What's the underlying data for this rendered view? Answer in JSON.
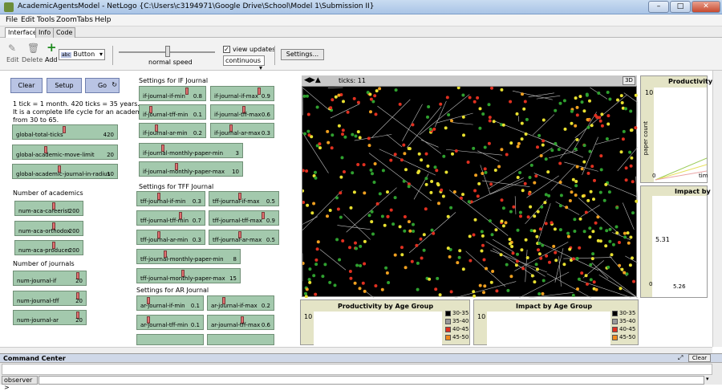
{
  "window": {
    "title": "AcademicAgentsModel - NetLogo {C:\\Users\\c3194971\\Google Drive\\School\\Model 1\\Submission II}"
  },
  "menu": [
    "File",
    "Edit",
    "Tools",
    "Zoom",
    "Tabs",
    "Help"
  ],
  "tabs": [
    "Interface",
    "Info",
    "Code"
  ],
  "toolbar": {
    "edit": "Edit",
    "delete": "Delete",
    "add": "Add",
    "widget_type": "Button",
    "speed": "normal speed",
    "view_updates": "view updates",
    "update_mode": "continuous",
    "settings": "Settings..."
  },
  "buttons": {
    "clear": "Clear",
    "setup": "Setup",
    "go": "Go"
  },
  "notes": {
    "line1": "1 tick = 1 month. 420 ticks = 35 years.",
    "line2": "It is a complete life cycle for an academic",
    "line3": "from 30 to 65.",
    "academics": "Number of academics",
    "journals": "Number of journals",
    "if_settings": "Settings for IF Journal",
    "tff_settings": "Settings for TFF Journal",
    "ar_settings": "Settings for AR Journal"
  },
  "sliders": {
    "global_total_ticks": {
      "name": "global-total-ticks",
      "value": "420",
      "frac": 0.5
    },
    "global_move_limit": {
      "name": "global-academic-move-limit",
      "value": "20",
      "frac": 0.3
    },
    "global_journal_radius": {
      "name": "global-academic-journal-in-radius",
      "value": "10",
      "frac": 0.45
    },
    "num_careerist": {
      "name": "num-aca-careerist",
      "value": "200",
      "frac": 0.6
    },
    "num_orthodox": {
      "name": "num-aca-orthodox",
      "value": "200",
      "frac": 0.6
    },
    "num_producer": {
      "name": "num-aca-producer",
      "value": "200",
      "frac": 0.6
    },
    "num_if": {
      "name": "num-journal-if",
      "value": "20",
      "frac": 0.98
    },
    "num_tff": {
      "name": "num-journal-tff",
      "value": "20",
      "frac": 0.98
    },
    "num_ar": {
      "name": "num-journal-ar",
      "value": "20",
      "frac": 0.98
    },
    "if_if_min": {
      "name": "if-journal-if-min",
      "value": "0.8",
      "frac": 0.78
    },
    "if_if_max": {
      "name": "if-journal-if-max",
      "value": "0.9",
      "frac": 0.85
    },
    "if_tff_min": {
      "name": "if-journal-tff-min",
      "value": "0.1",
      "frac": 0.12
    },
    "if_tff_max": {
      "name": "if-journal-tff-max",
      "value": "0.6",
      "frac": 0.55
    },
    "if_ar_min": {
      "name": "if-journal-ar-min",
      "value": "0.2",
      "frac": 0.22
    },
    "if_ar_max": {
      "name": "if-journal-ar-max",
      "value": "0.3",
      "frac": 0.3
    },
    "if_paper_min": {
      "name": "if-journal-monthly-paper-min",
      "value": "3",
      "frac": 0.2
    },
    "if_paper_max": {
      "name": "if-journal-monthly-paper-max",
      "value": "10",
      "frac": 0.35
    },
    "tff_if_min": {
      "name": "tff-journal-if-min",
      "value": "0.3",
      "frac": 0.3
    },
    "tff_if_max": {
      "name": "tff-journal-if-max",
      "value": "0.5",
      "frac": 0.45
    },
    "tff_tff_min": {
      "name": "tff-journal-tff-min",
      "value": "0.7",
      "frac": 0.68
    },
    "tff_tff_max": {
      "name": "tff-journal-tff-max",
      "value": "0.9",
      "frac": 0.85
    },
    "tff_ar_min": {
      "name": "tff-journal-ar-min",
      "value": "0.3",
      "frac": 0.3
    },
    "tff_ar_max": {
      "name": "tff-journal-ar-max",
      "value": "0.5",
      "frac": 0.45
    },
    "tff_paper_min": {
      "name": "tff-journal-monthly-paper-min",
      "value": "8",
      "frac": 0.25
    },
    "tff_paper_max": {
      "name": "tff-journal-monthly-paper-max",
      "value": "15",
      "frac": 0.45
    },
    "ar_if_min": {
      "name": "ar-journal-if-min",
      "value": "0.1",
      "frac": 0.12
    },
    "ar_if_max": {
      "name": "ar-journal-if-max",
      "value": "0.2",
      "frac": 0.2
    },
    "ar_tff_min": {
      "name": "ar-journal-tff-min",
      "value": "0.1",
      "frac": 0.12
    },
    "ar_tff_max": {
      "name": "ar-journal-tff-max",
      "value": "0.6",
      "frac": 0.55
    }
  },
  "world": {
    "ticks_label": "ticks: 11",
    "three_d": "3D"
  },
  "plots": {
    "prod_right": {
      "title": "Productivity by",
      "ymax": "10",
      "ylabel": "paper count",
      "xmin": "0",
      "xlabel": "tim"
    },
    "impact_right": {
      "title": "Impact by",
      "mid": "5.31",
      "ymin": "0",
      "bottom_val": "5.26"
    },
    "prod_age": {
      "title": "Productivity by Age Group",
      "ymax": "10"
    },
    "impact_age": {
      "title": "Impact by Age Group",
      "ymax": "10"
    },
    "legend": [
      {
        "label": "30-35",
        "color": "#000000"
      },
      {
        "label": "35-40",
        "color": "#9a9a9a"
      },
      {
        "label": "40-45",
        "color": "#e03020"
      },
      {
        "label": "45-50",
        "color": "#f08a1c"
      }
    ]
  },
  "command": {
    "title": "Command Center",
    "clear": "Clear",
    "prompt": "observer >"
  }
}
